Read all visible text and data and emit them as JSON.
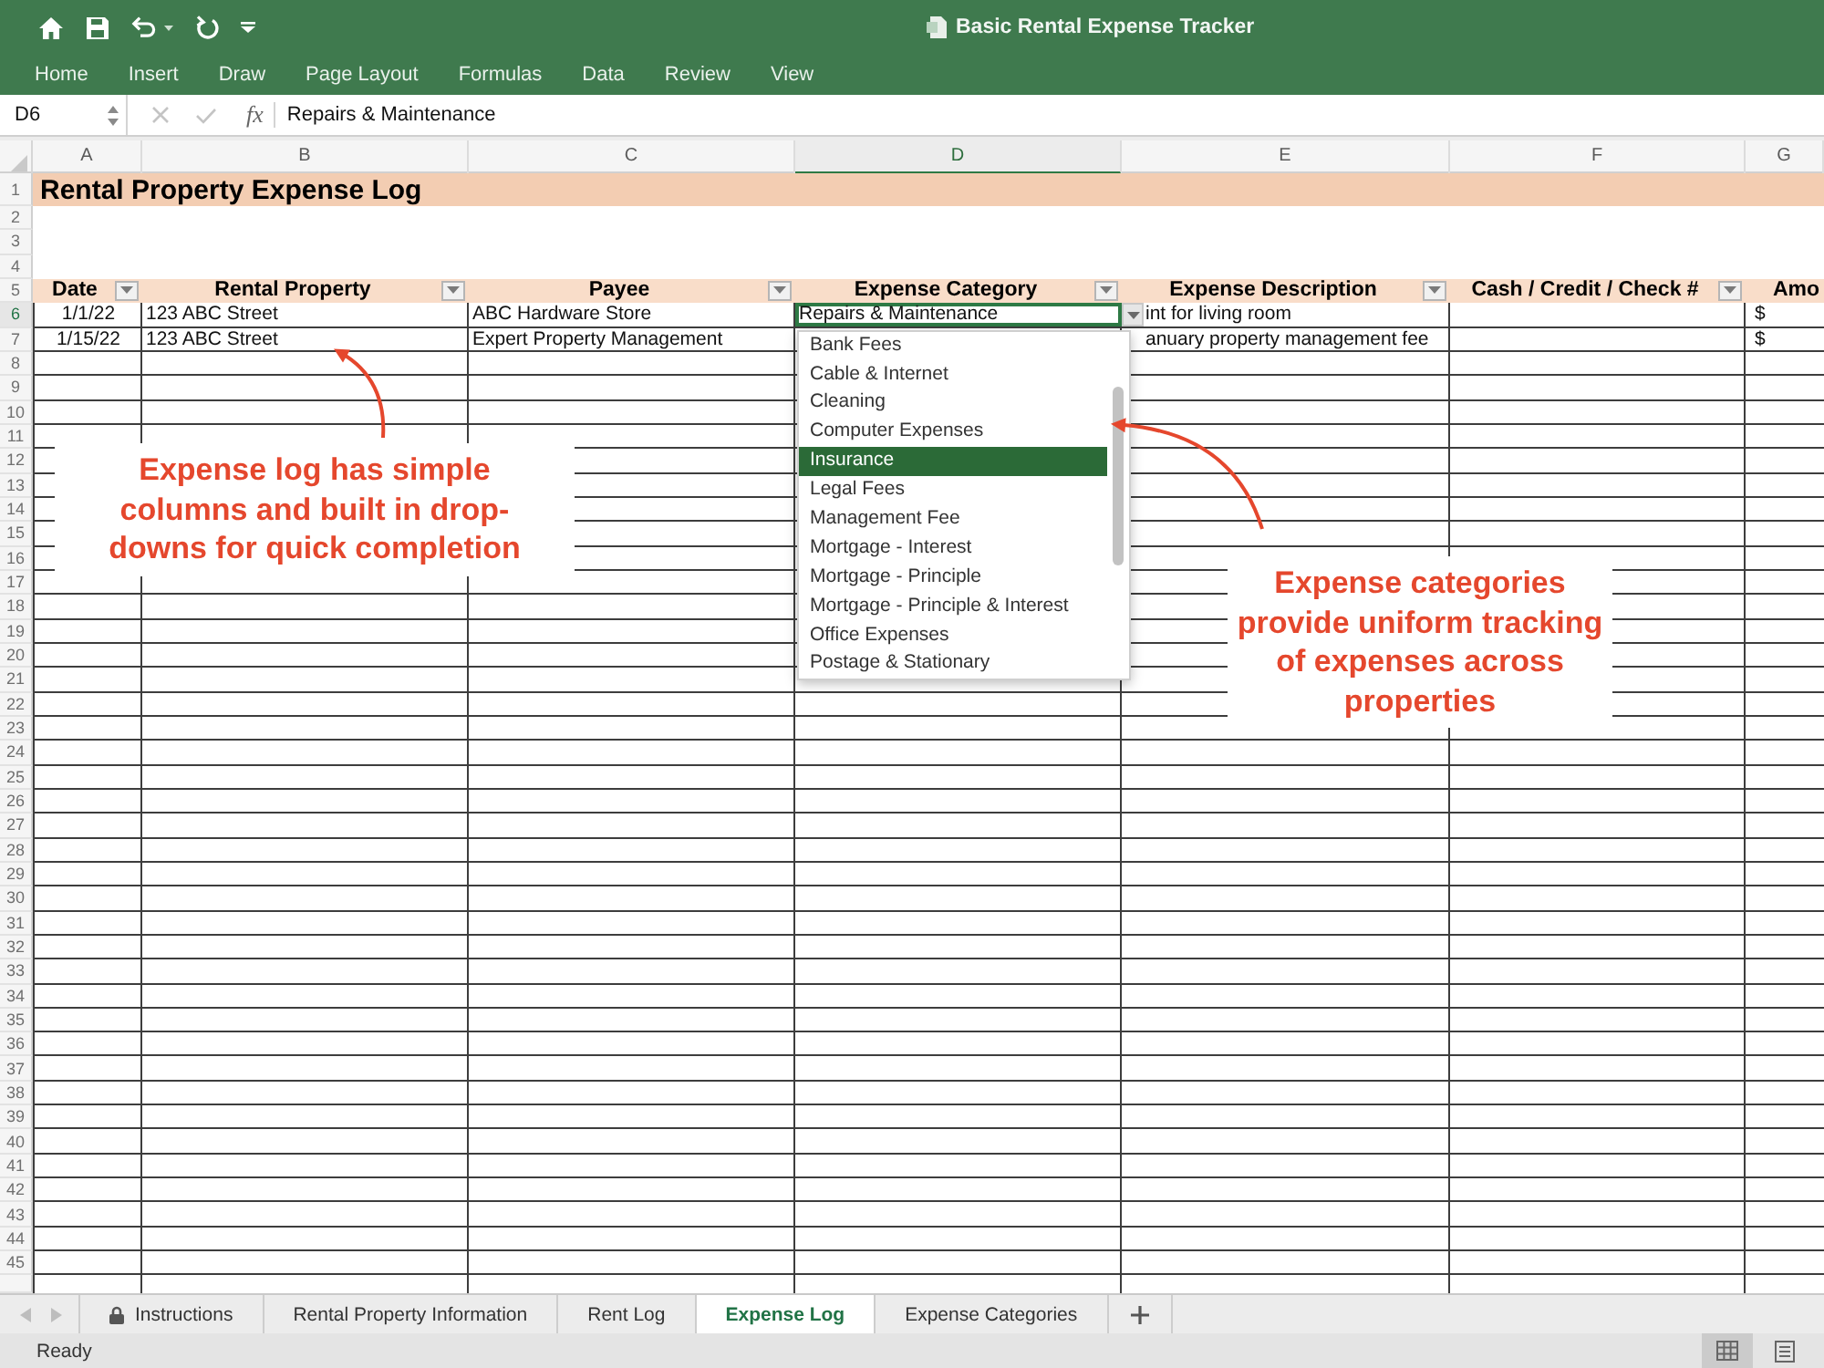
{
  "window": {
    "title": "Basic Rental Expense Tracker"
  },
  "ribbon_tabs": [
    "Home",
    "Insert",
    "Draw",
    "Page Layout",
    "Formulas",
    "Data",
    "Review",
    "View"
  ],
  "formula_bar": {
    "cell_reference": "D6",
    "function_label": "fx",
    "value": "Repairs & Maintenance"
  },
  "sheet": {
    "columns": [
      {
        "label": "A",
        "selected": false
      },
      {
        "label": "B",
        "selected": false
      },
      {
        "label": "C",
        "selected": false
      },
      {
        "label": "D",
        "selected": true
      },
      {
        "label": "E",
        "selected": false
      },
      {
        "label": "F",
        "selected": false
      },
      {
        "label": "G",
        "selected": false
      }
    ],
    "rows": [
      {
        "number": "1",
        "kind": "title",
        "selected": false,
        "text": "Rental Property Expense Log"
      },
      {
        "number": "2",
        "kind": "blank",
        "selected": false
      },
      {
        "number": "3",
        "kind": "blank",
        "selected": false
      },
      {
        "number": "4",
        "kind": "blank",
        "selected": false
      },
      {
        "number": "5",
        "kind": "header",
        "selected": false,
        "cells": [
          {
            "text": "Date",
            "filter": true
          },
          {
            "text": "Rental Property",
            "filter": true
          },
          {
            "text": "Payee",
            "filter": true
          },
          {
            "text": "Expense Category",
            "filter": true
          },
          {
            "text": "Expense Description",
            "filter": true
          },
          {
            "text": "Cash / Credit / Check #",
            "filter": true
          },
          {
            "text": "Amo",
            "filter": false
          }
        ]
      },
      {
        "number": "6",
        "kind": "data",
        "selected": true,
        "cells": [
          "1/1/22",
          "123 ABC Street",
          "ABC Hardware Store",
          "Repairs & Maintenance",
          "int for living room",
          null,
          "$"
        ]
      },
      {
        "number": "7",
        "kind": "data",
        "selected": false,
        "cells": [
          "1/15/22",
          "123 ABC Street",
          "Expert Property Management",
          null,
          "anuary property management fee",
          null,
          "$"
        ]
      },
      {
        "number": "8",
        "kind": "data",
        "selected": false
      },
      {
        "number": "9",
        "kind": "data",
        "selected": false
      },
      {
        "number": "10",
        "kind": "data",
        "selected": false
      },
      {
        "number": "11",
        "kind": "data",
        "selected": false
      },
      {
        "number": "12",
        "kind": "data",
        "selected": false
      },
      {
        "number": "13",
        "kind": "data",
        "selected": false
      },
      {
        "number": "14",
        "kind": "data",
        "selected": false
      },
      {
        "number": "15",
        "kind": "data",
        "selected": false
      },
      {
        "number": "16",
        "kind": "data",
        "selected": false
      },
      {
        "number": "17",
        "kind": "data",
        "selected": false
      },
      {
        "number": "18",
        "kind": "data",
        "selected": false
      },
      {
        "number": "19",
        "kind": "data",
        "selected": false
      },
      {
        "number": "20",
        "kind": "data",
        "selected": false
      },
      {
        "number": "21",
        "kind": "data",
        "selected": false
      },
      {
        "number": "22",
        "kind": "data",
        "selected": false
      },
      {
        "number": "23",
        "kind": "data",
        "selected": false
      },
      {
        "number": "24",
        "kind": "data",
        "selected": false
      },
      {
        "number": "25",
        "kind": "data",
        "selected": false
      },
      {
        "number": "26",
        "kind": "data",
        "selected": false
      },
      {
        "number": "27",
        "kind": "data",
        "selected": false
      },
      {
        "number": "28",
        "kind": "data",
        "selected": false
      },
      {
        "number": "29",
        "kind": "data",
        "selected": false
      },
      {
        "number": "30",
        "kind": "data",
        "selected": false
      },
      {
        "number": "31",
        "kind": "data",
        "selected": false
      },
      {
        "number": "32",
        "kind": "data",
        "selected": false
      },
      {
        "number": "33",
        "kind": "data",
        "selected": false
      },
      {
        "number": "34",
        "kind": "data",
        "selected": false
      },
      {
        "number": "35",
        "kind": "data",
        "selected": false
      },
      {
        "number": "36",
        "kind": "data",
        "selected": false
      },
      {
        "number": "37",
        "kind": "data",
        "selected": false
      },
      {
        "number": "38",
        "kind": "data",
        "selected": false
      },
      {
        "number": "39",
        "kind": "data",
        "selected": false
      },
      {
        "number": "40",
        "kind": "data",
        "selected": false
      },
      {
        "number": "41",
        "kind": "data",
        "selected": false
      },
      {
        "number": "42",
        "kind": "data",
        "selected": false
      },
      {
        "number": "43",
        "kind": "data",
        "selected": false
      },
      {
        "number": "44",
        "kind": "data",
        "selected": false
      },
      {
        "number": "45",
        "kind": "data",
        "selected": false
      }
    ],
    "dropdown": {
      "items": [
        {
          "label": "Bank Fees",
          "selected": false
        },
        {
          "label": "Cable & Internet",
          "selected": false
        },
        {
          "label": "Cleaning",
          "selected": false
        },
        {
          "label": "Computer Expenses",
          "selected": false
        },
        {
          "label": "Insurance",
          "selected": true
        },
        {
          "label": "Legal Fees",
          "selected": false
        },
        {
          "label": "Management Fee",
          "selected": false
        },
        {
          "label": "Mortgage - Interest",
          "selected": false
        },
        {
          "label": "Mortgage - Principle",
          "selected": false
        },
        {
          "label": "Mortgage - Principle & Interest",
          "selected": false
        },
        {
          "label": "Office Expenses",
          "selected": false
        },
        {
          "label": "Postage & Stationary",
          "selected": false
        }
      ]
    }
  },
  "annotations": [
    {
      "text": "Expense log has simple columns and built in drop-downs for quick completion"
    },
    {
      "text": "Expense categories provide uniform tracking of expenses across properties"
    }
  ],
  "sheet_tabs": [
    {
      "label": "Instructions",
      "locked": true,
      "selected": false
    },
    {
      "label": "Rental Property Information",
      "locked": false,
      "selected": false
    },
    {
      "label": "Rent Log",
      "locked": false,
      "selected": false
    },
    {
      "label": "Expense Log",
      "locked": false,
      "selected": true
    },
    {
      "label": "Expense Categories",
      "locked": false,
      "selected": false
    }
  ],
  "status_bar": {
    "text": "Ready",
    "views": [
      {
        "kind": "normal",
        "selected": true
      },
      {
        "kind": "page_layout",
        "selected": false
      }
    ]
  }
}
